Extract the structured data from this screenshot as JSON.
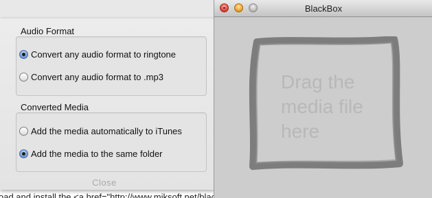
{
  "background_page": {
    "partial_text": "oad and install the <a href=\"http://www.miksoft.net/blackbox.htm\">BlackBox app here</a>. Open"
  },
  "preferences": {
    "audio_format": {
      "title": "Audio Format",
      "options": [
        {
          "label": "Convert any audio format to ringtone",
          "selected": true
        },
        {
          "label": "Convert any audio format to .mp3",
          "selected": false
        }
      ]
    },
    "converted_media": {
      "title": "Converted Media",
      "options": [
        {
          "label": "Add the media automatically to iTunes",
          "selected": false
        },
        {
          "label": "Add the media to the same folder",
          "selected": true
        }
      ]
    },
    "close_label": "Close"
  },
  "window": {
    "title": "BlackBox",
    "traffic_lights": [
      "close",
      "minimize",
      "zoom"
    ],
    "drop_zone_text": [
      "Drag the",
      "media file",
      "here"
    ]
  },
  "colors": {
    "radio_selected": "#6a95d4",
    "dropzone_stroke": "#6e6e6e",
    "drop_text": "#b8b8b8"
  }
}
